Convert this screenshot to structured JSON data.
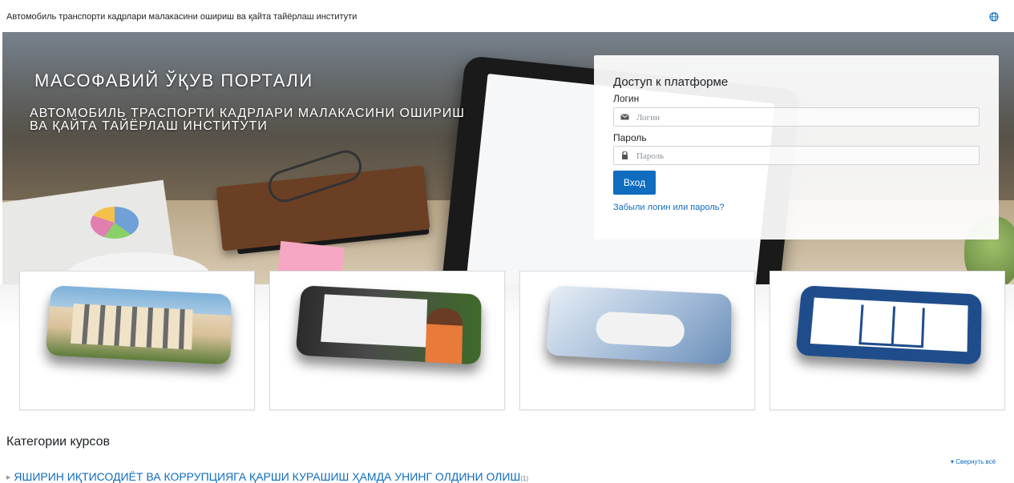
{
  "header": {
    "site_name": "Автомобиль транспорти кадрлари малакасини ошириш ва қайта тайёрлаш институти",
    "language_icon": "globe-icon"
  },
  "hero": {
    "title": "МАСОФАВИЙ ЎҚУВ ПОРТАЛИ",
    "subtitle": "АВТОМОБИЛЬ ТРАСПОРТИ КАДРЛАРИ МАЛАКАСИНИ ОШИРИШ ВА ҚАЙТА ТАЙЁРЛАШ ИНСТИТУТИ"
  },
  "login": {
    "title": "Доступ к платформе",
    "username_label": "Логин",
    "username_placeholder": "Логин",
    "username_icon": "envelope-icon",
    "password_label": "Пароль",
    "password_placeholder": "Пароль",
    "password_icon": "lock-icon",
    "submit_label": "Вход",
    "forgot_link": "Забыли логин или пароль?"
  },
  "tiles": [
    {
      "image": "institute-building-image"
    },
    {
      "image": "online-learning-image"
    },
    {
      "image": "typing-hands-image"
    },
    {
      "image": "book-icon-image"
    }
  ],
  "course_categories": {
    "heading": "Категории курсов",
    "collapse_all": "Свернуть всё",
    "items": [
      {
        "name": "ЯШИРИН ИҚТИСОДИЁТ ВА КОРРУПЦИЯГА ҚАРШИ КУРАШИШ ҲАМДА УНИНГ ОЛДИНИ ОЛИШ",
        "count": "(1)"
      }
    ]
  },
  "colors": {
    "link": "#0f6cbf",
    "button": "#0f6cbf",
    "text": "#1d2125"
  }
}
